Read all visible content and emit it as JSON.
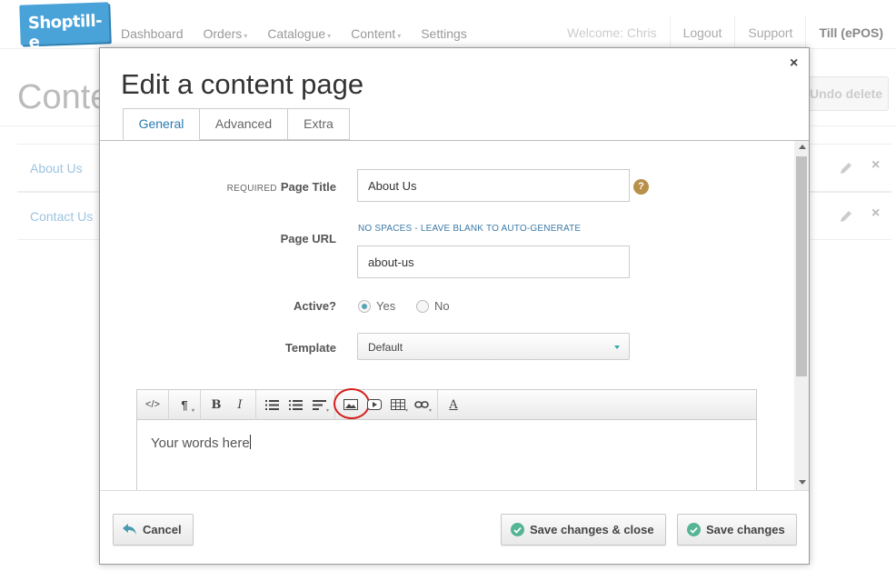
{
  "app": {
    "logo_text": "Shoptill-e",
    "nav": [
      {
        "label": "Dashboard",
        "dropdown": false
      },
      {
        "label": "Orders",
        "dropdown": true
      },
      {
        "label": "Catalogue",
        "dropdown": true
      },
      {
        "label": "Content",
        "dropdown": true
      },
      {
        "label": "Settings",
        "dropdown": false
      }
    ],
    "welcome": "Welcome: Chris",
    "logout": "Logout",
    "support": "Support",
    "till": "Till (ePOS)"
  },
  "background": {
    "page_title": "Conte",
    "undo_button": "Undo delete",
    "rows": [
      "About Us",
      "Contact Us"
    ]
  },
  "modal": {
    "title": "Edit a content page",
    "close_glyph": "×",
    "tabs": [
      "General",
      "Advanced",
      "Extra"
    ],
    "active_tab": "General",
    "form": {
      "required_tag": "REQUIRED",
      "page_title_label": "Page Title",
      "page_title_value": "About Us",
      "help_glyph": "?",
      "page_url_label": "Page URL",
      "page_url_hint": "NO SPACES - LEAVE BLANK TO AUTO-GENERATE",
      "page_url_value": "about-us",
      "active_label": "Active?",
      "active_yes": "Yes",
      "active_no": "No",
      "active_selected": "Yes",
      "template_label": "Template",
      "template_value": "Default"
    },
    "editor": {
      "toolbar_icons": [
        "code-icon",
        "paragraph-icon",
        "bold-icon",
        "italic-icon",
        "unordered-list-icon",
        "ordered-list-icon",
        "align-icon",
        "image-icon",
        "video-icon",
        "table-icon",
        "link-icon",
        "font-color-icon"
      ],
      "highlighted_icon": "image-icon",
      "content": "Your words here"
    },
    "buttons": {
      "cancel": "Cancel",
      "save_close": "Save changes & close",
      "save": "Save changes"
    }
  },
  "colors": {
    "logo_bg": "#4aa3d8",
    "active_tab": "#2a7ab0",
    "hint_text": "#3c7aa8",
    "check_icon": "#55b595",
    "annotation_circle": "#d61d1d"
  }
}
